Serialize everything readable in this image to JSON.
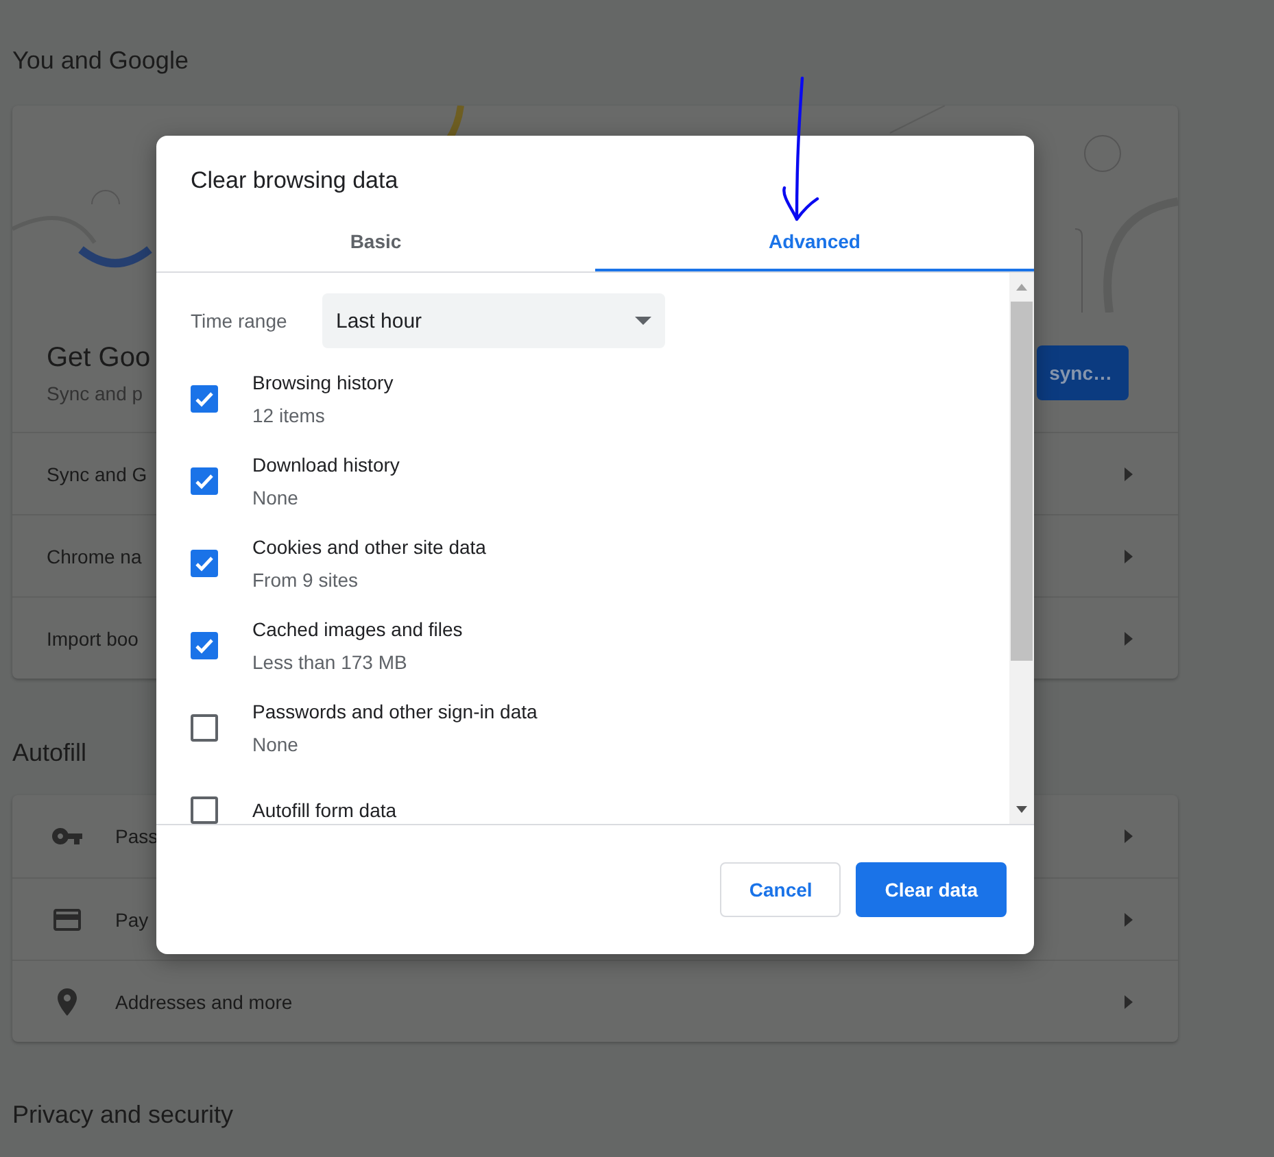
{
  "settings_page": {
    "sections": [
      {
        "heading": "You and Google",
        "sync_card": {
          "title": "Get Goo",
          "subtitle": "Sync and p",
          "button": "sync…"
        },
        "rows": [
          {
            "label": "Sync and G"
          },
          {
            "label": "Chrome na"
          },
          {
            "label": "Import boo"
          }
        ]
      },
      {
        "heading": "Autofill",
        "rows": [
          {
            "label": "Pass"
          },
          {
            "label": "Pay"
          },
          {
            "label": "Addresses and more"
          }
        ]
      },
      {
        "heading": "Privacy and security"
      }
    ]
  },
  "dialog": {
    "title": "Clear browsing data",
    "tabs": [
      {
        "label": "Basic",
        "selected": false
      },
      {
        "label": "Advanced",
        "selected": true
      }
    ],
    "time_range": {
      "label": "Time range",
      "value": "Last hour"
    },
    "items": [
      {
        "label": "Browsing history",
        "detail": "12 items",
        "checked": true
      },
      {
        "label": "Download history",
        "detail": "None",
        "checked": true
      },
      {
        "label": "Cookies and other site data",
        "detail": "From 9 sites",
        "checked": true
      },
      {
        "label": "Cached images and files",
        "detail": "Less than 173 MB",
        "checked": true
      },
      {
        "label": "Passwords and other sign-in data",
        "detail": "None",
        "checked": false
      },
      {
        "label": "Autofill form data",
        "checked": false
      }
    ],
    "buttons": {
      "cancel": "Cancel",
      "confirm": "Clear data"
    }
  }
}
